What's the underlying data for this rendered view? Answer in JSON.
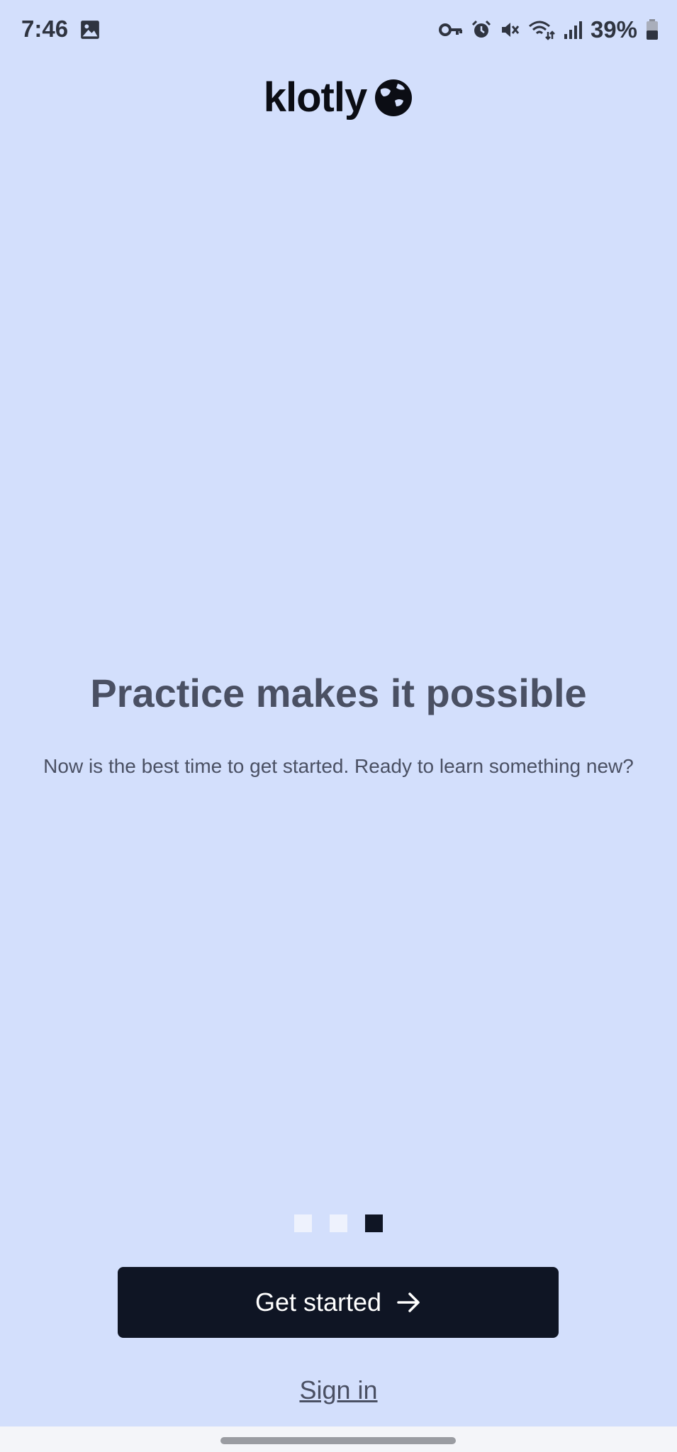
{
  "status_bar": {
    "time": "7:46",
    "battery_percent": "39%",
    "icons": [
      "gallery-icon",
      "vpn-key-icon",
      "alarm-icon",
      "mute-icon",
      "wifi-icon",
      "signal-icon",
      "battery-icon"
    ]
  },
  "brand": {
    "name": "klotly",
    "logo_icon": "globe-logo-icon"
  },
  "onboarding": {
    "title": "Practice makes it possible",
    "description": "Now is the best time to get started. Ready to learn something new?",
    "pagination": {
      "total": 3,
      "active_index": 2
    }
  },
  "actions": {
    "get_started_label": "Get started",
    "get_started_icon": "arrow-right-icon",
    "sign_in_label": "Sign in"
  },
  "colors": {
    "background": "#d3dffc",
    "primary": "#0f1524",
    "text": "#4a5063"
  }
}
